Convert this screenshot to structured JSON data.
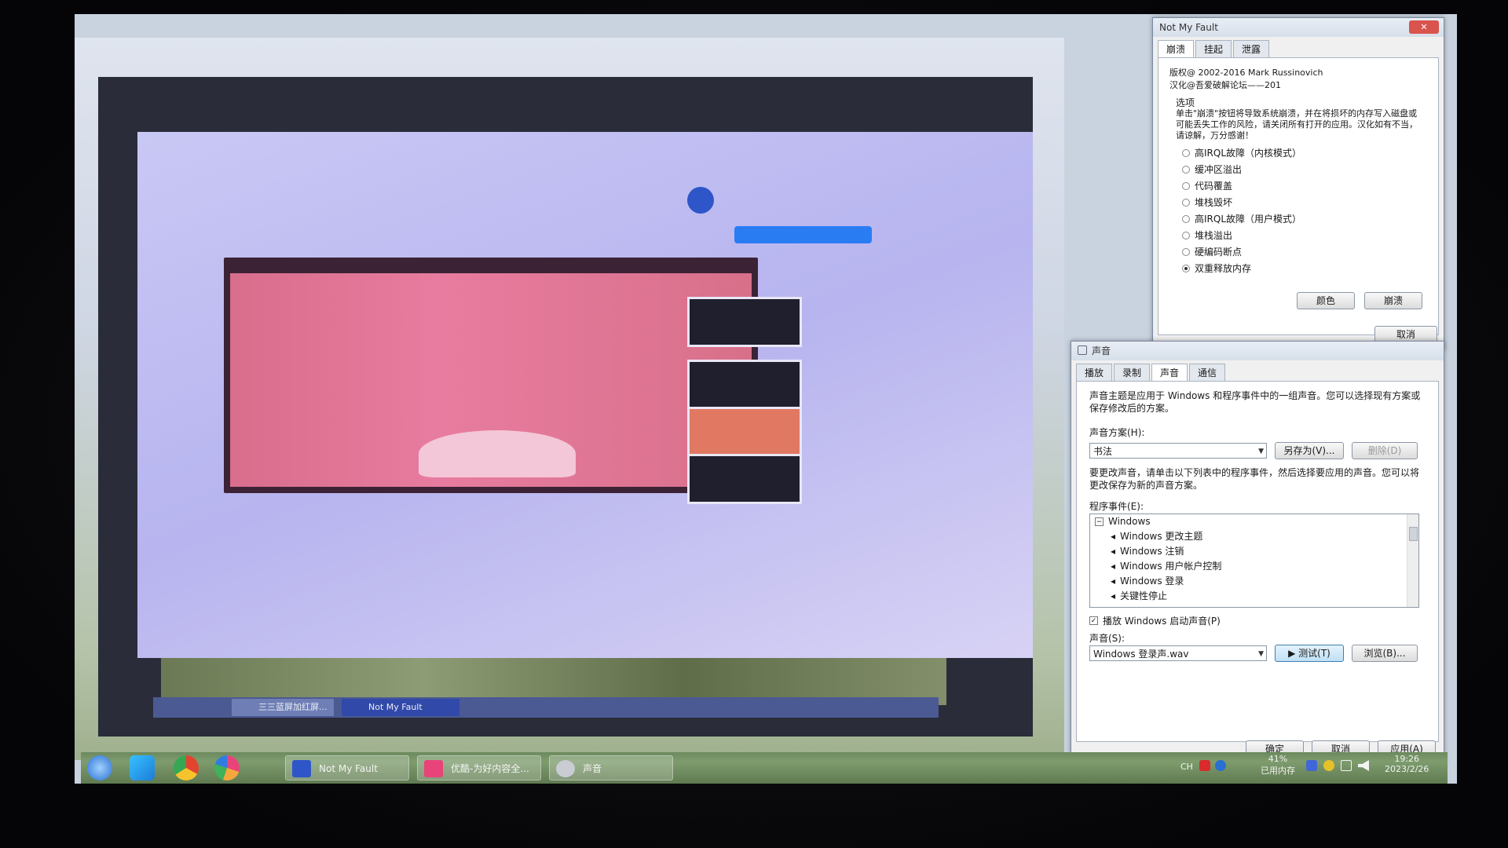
{
  "inner_screen": {
    "taskbar_items": [
      "三三蓝屏加红屏...",
      "Not My Fault"
    ]
  },
  "notmyfault": {
    "title": "Not My Fault",
    "close_glyph": "✕",
    "tabs": [
      "崩溃",
      "挂起",
      "泄露"
    ],
    "active_tab": 0,
    "copyright": "版权@ 2002-2016 Mark Russinovich",
    "localization": "汉化@吾爱破解论坛——201",
    "options_label": "选项",
    "warning": "单击\"崩溃\"按钮将导致系统崩溃，并在将损坏的内存写入磁盘或可能丢失工作的风险，请关闭所有打开的应用。汉化如有不当，请谅解，万分感谢！",
    "options": [
      {
        "label": "高IRQL故障（内核模式）",
        "checked": false
      },
      {
        "label": "缓冲区溢出",
        "checked": false
      },
      {
        "label": "代码覆盖",
        "checked": false
      },
      {
        "label": "堆栈毁坏",
        "checked": false
      },
      {
        "label": "高IRQL故障（用户模式）",
        "checked": false
      },
      {
        "label": "堆栈溢出",
        "checked": false
      },
      {
        "label": "硬编码断点",
        "checked": false
      },
      {
        "label": "双重释放内存",
        "checked": true
      }
    ],
    "color_button": "颜色",
    "crash_button": "崩溃",
    "cancel_button": "取消"
  },
  "sound": {
    "title": "声音",
    "tabs": [
      "播放",
      "录制",
      "声音",
      "通信"
    ],
    "active_tab": 2,
    "intro": "声音主题是应用于 Windows 和程序事件中的一组声音。您可以选择现有方案或保存修改后的方案。",
    "scheme_label": "声音方案(H):",
    "scheme_value": "书法",
    "save_as_button": "另存为(V)...",
    "delete_button": "删除(D)",
    "change_desc": "要更改声音，请单击以下列表中的程序事件，然后选择要应用的声音。您可以将更改保存为新的声音方案。",
    "events_label": "程序事件(E):",
    "events": [
      "Windows",
      "Windows 更改主题",
      "Windows 注销",
      "Windows 用户帐户控制",
      "Windows 登录",
      "关键性停止"
    ],
    "startup_checkbox_label": "播放 Windows 启动声音(P)",
    "startup_checked": true,
    "sounds_label": "声音(S):",
    "sound_value": "Windows 登录声.wav",
    "test_button": "▶ 测试(T)",
    "browse_button": "浏览(B)...",
    "ok_button": "确定",
    "cancel_button": "取消",
    "apply_button": "应用(A)"
  },
  "taskbar": {
    "items": [
      {
        "label": "Not My Fault",
        "color": "#2f56c9"
      },
      {
        "label": "优酷-为好内容全...",
        "color": "#e8447a"
      },
      {
        "label": "声音",
        "color": "#c9ccd2"
      }
    ],
    "tray": {
      "lang": "CH",
      "memory_percent": "41%",
      "memory_label": "已用内存",
      "time": "19:26",
      "date": "2023/2/26"
    }
  },
  "colors": {
    "accent": "#2f56c9",
    "close": "#d9544d"
  }
}
